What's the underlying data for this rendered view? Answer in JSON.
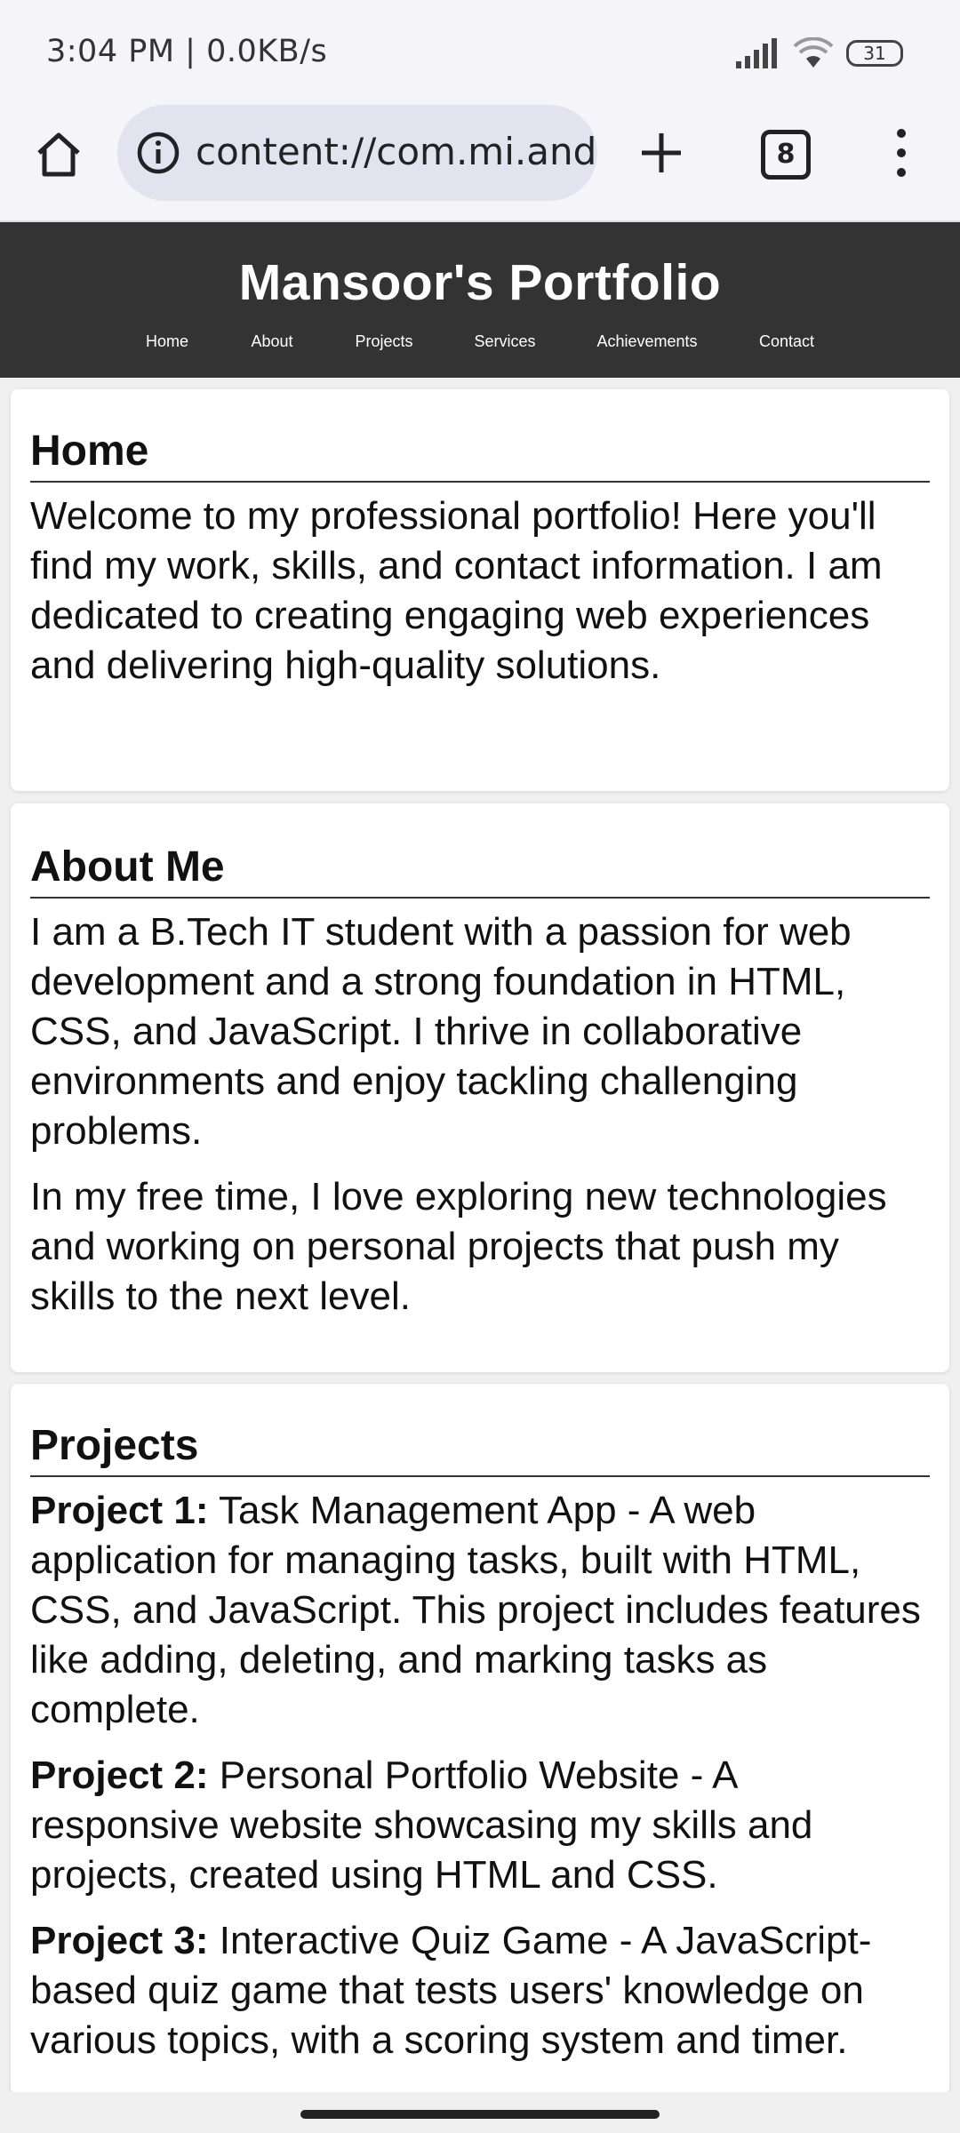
{
  "status_bar": {
    "time_net": "3:04 PM | 0.0KB/s",
    "battery": "31",
    "icons": [
      "signal-icon",
      "wifi-icon",
      "battery-icon"
    ]
  },
  "browser": {
    "url": "content://com.mi.android",
    "tab_count": "8",
    "icons": [
      "home-icon",
      "info-icon",
      "plus-icon",
      "tabs-icon",
      "menu-dots-icon"
    ]
  },
  "site": {
    "title": "Mansoor's Portfolio",
    "nav": [
      "Home",
      "About",
      "Projects",
      "Services",
      "Achievements",
      "Contact"
    ]
  },
  "sections": {
    "home": {
      "heading": "Home",
      "text": "Welcome to my professional portfolio! Here you'll find my work, skills, and contact information. I am dedicated to creating engaging web experiences and delivering high-quality solutions."
    },
    "about": {
      "heading": "About Me",
      "p1": "I am a B.Tech IT student with a passion for web development and a strong foundation in HTML, CSS, and JavaScript. I thrive in collaborative environments and enjoy tackling challenging problems.",
      "p2": "In my free time, I love exploring new technologies and working on personal projects that push my skills to the next level."
    },
    "projects": {
      "heading": "Projects",
      "items": [
        {
          "label": "Project 1:",
          "text": " Task Management App - A web application for managing tasks, built with HTML, CSS, and JavaScript. This project includes features like adding, deleting, and marking tasks as complete."
        },
        {
          "label": "Project 2:",
          "text": " Personal Portfolio Website - A responsive website showcasing my skills and projects, created using HTML and CSS."
        },
        {
          "label": "Project 3:",
          "text": " Interactive Quiz Game - A JavaScript-based quiz game that tests users' knowledge on various topics, with a scoring system and timer."
        }
      ]
    }
  },
  "colors": {
    "header_bg": "#333333",
    "page_bg": "#f0f0f0",
    "card_bg": "#ffffff",
    "browser_bg": "#f4f4f9",
    "url_pill": "#e3e3f0"
  }
}
